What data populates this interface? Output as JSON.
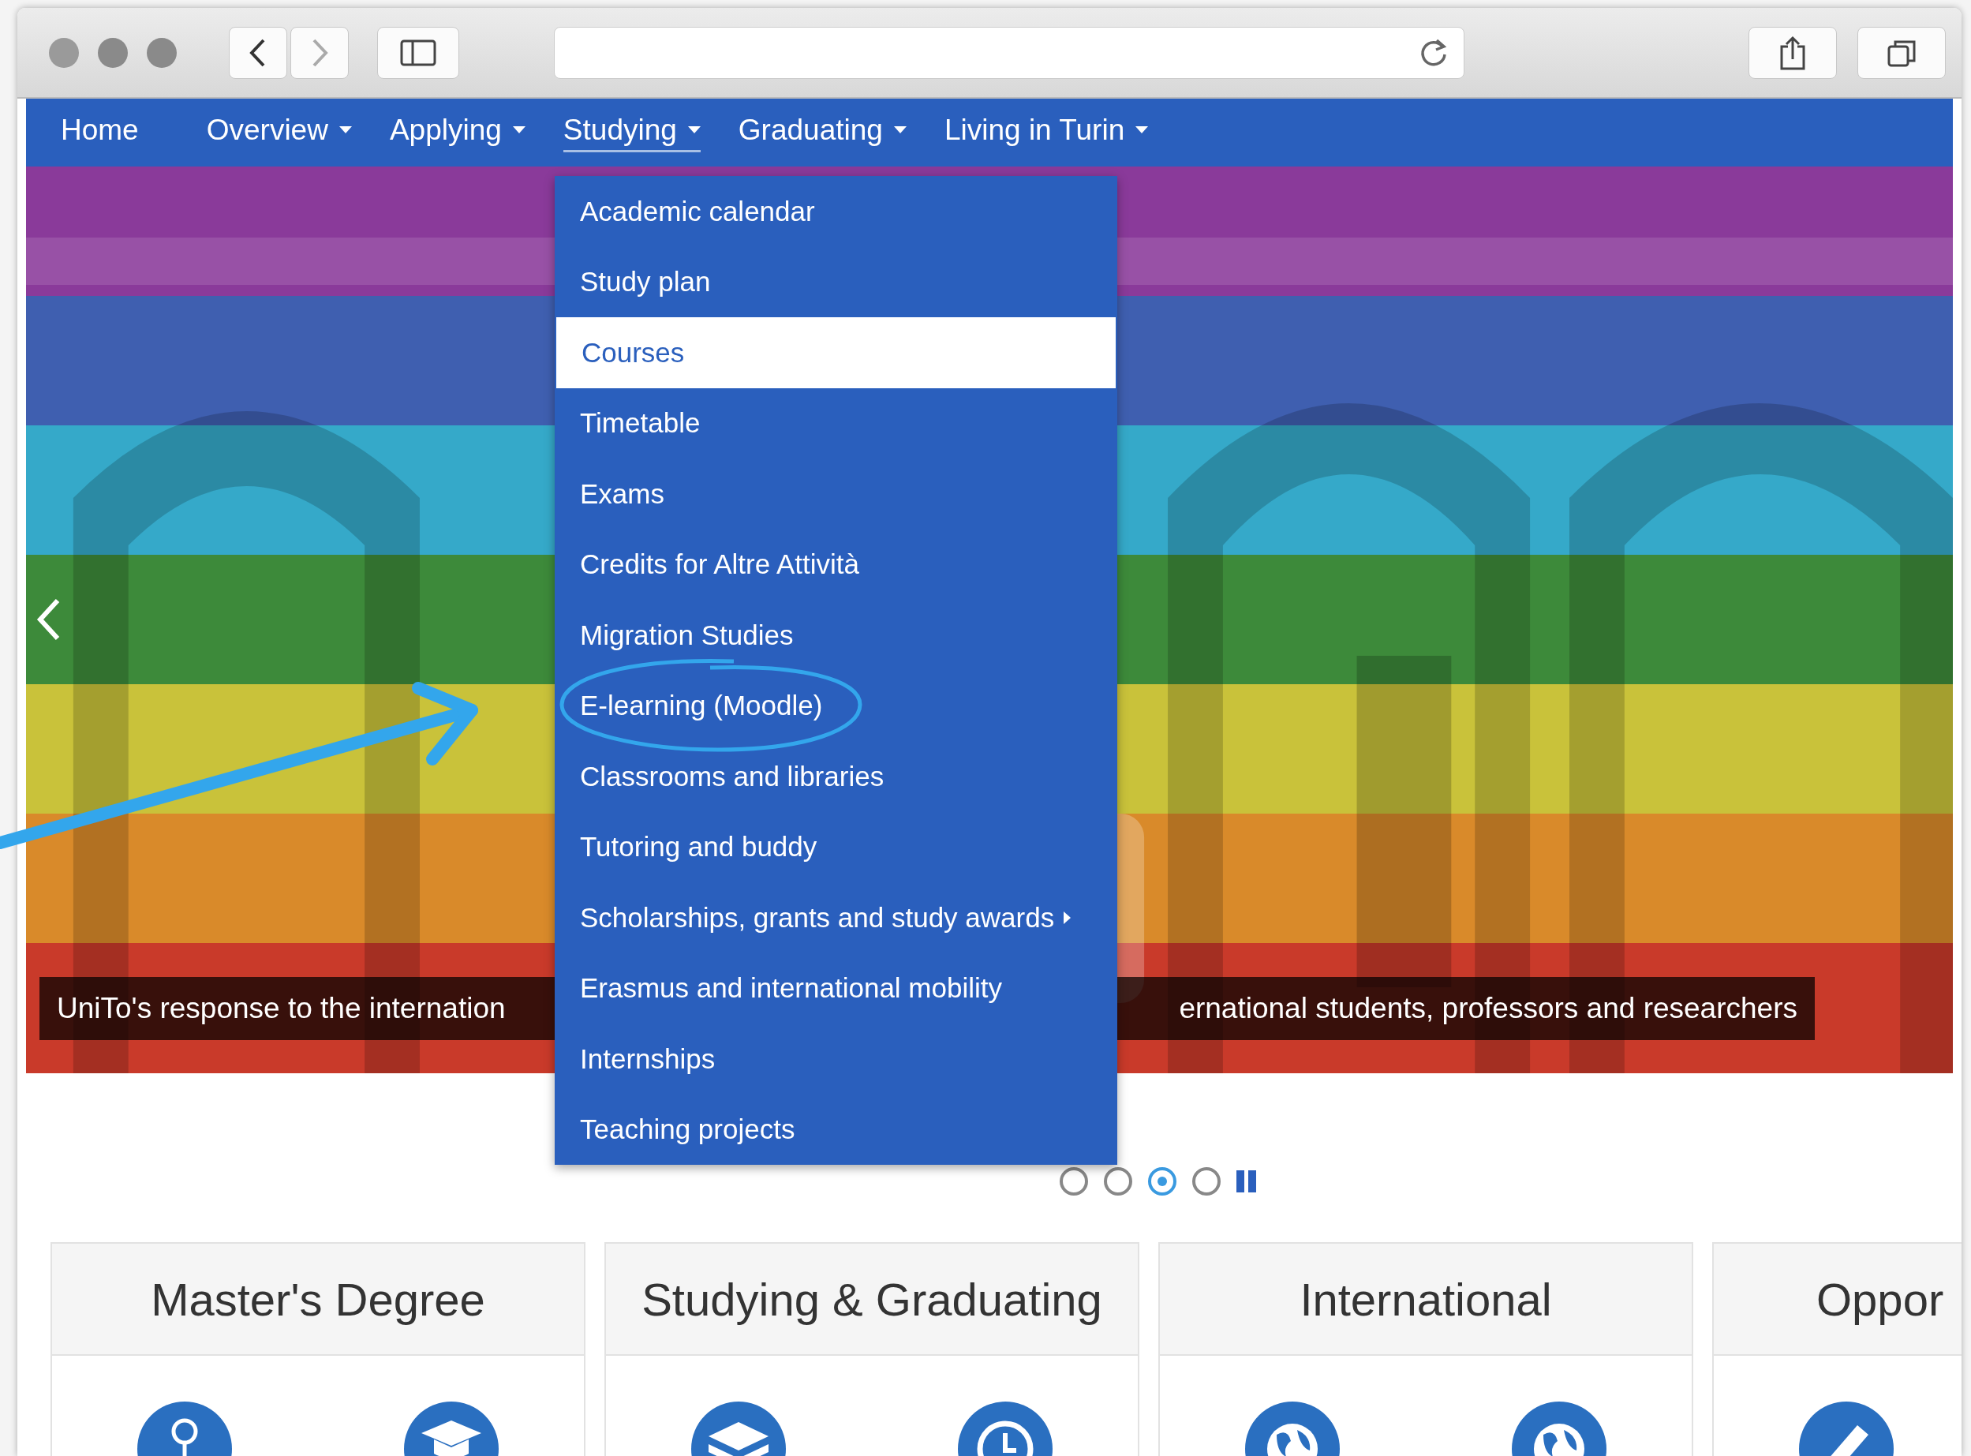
{
  "nav": {
    "items": [
      {
        "label": "Home",
        "has_menu": false,
        "open": false
      },
      {
        "label": "Overview",
        "has_menu": true,
        "open": false
      },
      {
        "label": "Applying",
        "has_menu": true,
        "open": false
      },
      {
        "label": "Studying",
        "has_menu": true,
        "open": true
      },
      {
        "label": "Graduating",
        "has_menu": true,
        "open": false
      },
      {
        "label": "Living in Turin",
        "has_menu": true,
        "open": false
      }
    ]
  },
  "dropdown": {
    "items": [
      {
        "label": "Academic calendar",
        "selected": false,
        "has_submenu": false
      },
      {
        "label": "Study plan",
        "selected": false,
        "has_submenu": false
      },
      {
        "label": "Courses",
        "selected": true,
        "has_submenu": false
      },
      {
        "label": "Timetable",
        "selected": false,
        "has_submenu": false
      },
      {
        "label": "Exams",
        "selected": false,
        "has_submenu": false
      },
      {
        "label": "Credits for Altre Attività",
        "selected": false,
        "has_submenu": false
      },
      {
        "label": "Migration Studies",
        "selected": false,
        "has_submenu": false
      },
      {
        "label": "E-learning (Moodle)",
        "selected": false,
        "has_submenu": false
      },
      {
        "label": "Classrooms and libraries",
        "selected": false,
        "has_submenu": false
      },
      {
        "label": "Tutoring and buddy",
        "selected": false,
        "has_submenu": false
      },
      {
        "label": "Scholarships, grants and study awards",
        "selected": false,
        "has_submenu": true
      },
      {
        "label": "Erasmus and international mobility",
        "selected": false,
        "has_submenu": false
      },
      {
        "label": "Internships",
        "selected": false,
        "has_submenu": false
      },
      {
        "label": "Teaching projects",
        "selected": false,
        "has_submenu": false
      }
    ]
  },
  "slider": {
    "caption_left": "UniTo's response to the internation",
    "caption_right": "ernational students, professors and researchers",
    "dots": [
      {
        "selected": false
      },
      {
        "selected": false
      },
      {
        "selected": true
      },
      {
        "selected": false
      }
    ]
  },
  "cards": [
    {
      "title": "Master's Degree",
      "icons": [
        {
          "kind": "pin"
        },
        {
          "kind": "cap"
        }
      ]
    },
    {
      "title": "Studying & Graduating",
      "icons": [
        {
          "kind": "book"
        },
        {
          "kind": "clock"
        }
      ]
    },
    {
      "title": "International",
      "icons": [
        {
          "kind": "globe"
        },
        {
          "kind": "globe"
        }
      ]
    },
    {
      "title": "Oppor",
      "icons": [
        {
          "kind": "pencil"
        }
      ]
    }
  ]
}
